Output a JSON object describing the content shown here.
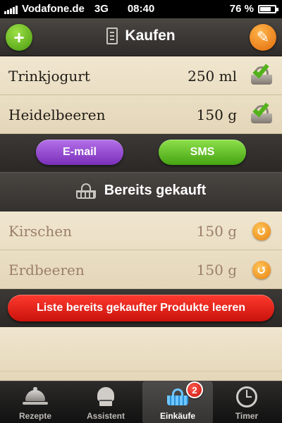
{
  "status_bar": {
    "carrier": "Vodafone.de",
    "network": "3G",
    "time": "08:40",
    "battery_label": "76 %",
    "battery_level": 0.76
  },
  "nav": {
    "title": "Kaufen",
    "add_icon": "plus-icon",
    "edit_icon": "pencil-icon",
    "add_glyph": "+",
    "edit_glyph": "✎"
  },
  "to_buy": [
    {
      "name": "Trinkjogurt",
      "qty": "250 ml"
    },
    {
      "name": "Heidelbeeren",
      "qty": "150 g"
    }
  ],
  "share": {
    "email_label": "E-mail",
    "sms_label": "SMS"
  },
  "bought_section": {
    "title": "Bereits gekauft",
    "items": [
      {
        "name": "Kirschen",
        "qty": "150 g"
      },
      {
        "name": "Erdbeeren",
        "qty": "150 g"
      }
    ],
    "restore_glyph": "↺",
    "clear_label": "Liste bereits gekaufter Produkte leeren"
  },
  "tabs": [
    {
      "label": "Rezepte",
      "icon": "cloche-icon"
    },
    {
      "label": "Assistent",
      "icon": "chef-hat-icon"
    },
    {
      "label": "Einkäufe",
      "icon": "basket-icon",
      "badge": "2",
      "active": true
    },
    {
      "label": "Timer",
      "icon": "clock-icon"
    }
  ],
  "colors": {
    "add_button": "#6cc023",
    "edit_button": "#f0901c",
    "email_button": "#9a4fd6",
    "sms_button": "#6cc023",
    "clear_button": "#e0201a",
    "paper": "#ece0c6"
  }
}
